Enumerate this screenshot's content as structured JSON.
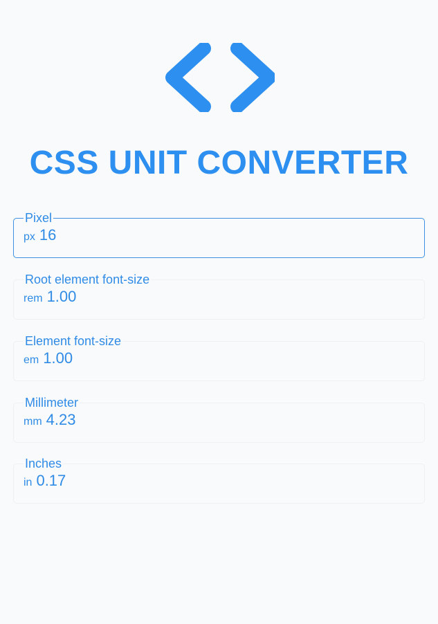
{
  "logo": {
    "icon": "code-brackets-icon",
    "color": "#2d8ff0"
  },
  "title": "CSS UNIT CONVERTER",
  "units": [
    {
      "label": "Pixel",
      "suffix": "px",
      "value": "16"
    },
    {
      "label": "Root element font-size",
      "suffix": "rem",
      "value": "1.00"
    },
    {
      "label": "Element font-size",
      "suffix": "em",
      "value": "1.00"
    },
    {
      "label": "Millimeter",
      "suffix": "mm",
      "value": "4.23"
    },
    {
      "label": "Inches",
      "suffix": "in",
      "value": "0.17"
    }
  ]
}
